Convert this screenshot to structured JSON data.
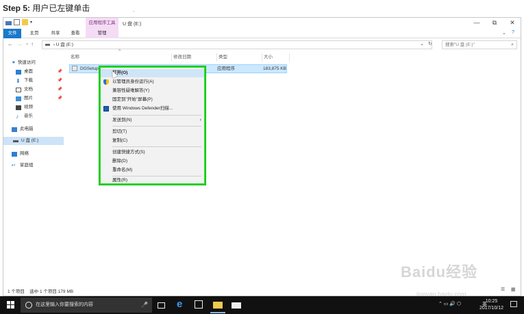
{
  "caption": {
    "step": "Step 5:",
    "text": "用户已左键单击"
  },
  "window": {
    "title": "U 盘 (E:)",
    "context_tab": "应用程序工具",
    "controls": [
      "—",
      "⧉",
      "✕"
    ]
  },
  "ribbon": {
    "tabs": [
      "文件",
      "主页",
      "共享",
      "查看",
      "管理"
    ]
  },
  "address": {
    "path": "U 盘 (E:)",
    "search_placeholder": "搜索\"U 盘 (E:)\""
  },
  "sidebar": {
    "items": [
      {
        "label": "快速访问",
        "pinned": false
      },
      {
        "label": "桌面",
        "pinned": true
      },
      {
        "label": "下载",
        "pinned": true
      },
      {
        "label": "文档",
        "pinned": true
      },
      {
        "label": "图片",
        "pinned": true
      },
      {
        "label": "视频",
        "pinned": false
      },
      {
        "label": "音乐",
        "pinned": false
      },
      {
        "label": "此电脑",
        "pinned": false
      },
      {
        "label": "U 盘 (E:)",
        "pinned": false
      },
      {
        "label": "网络",
        "pinned": false
      },
      {
        "label": "家庭组",
        "pinned": false
      }
    ]
  },
  "file_list": {
    "columns": [
      "名称",
      "修改日期",
      "类型",
      "大小"
    ],
    "rows": [
      {
        "name": "DGSetup",
        "date": "",
        "type": "应用程序",
        "size": "183,875 KB"
      }
    ]
  },
  "context_menu": {
    "items": [
      "打开(O)",
      "以管理员身份运行(A)",
      "兼容性疑难解答(Y)",
      "固定到\"开始\"屏幕(P)",
      "使用 Windows Defender扫描...",
      "发送到(N)",
      "剪切(T)",
      "复制(C)",
      "创建快捷方式(S)",
      "删除(D)",
      "重命名(M)",
      "属性(R)"
    ]
  },
  "status_bar": {
    "count": "1 个项目",
    "selected": "选中 1 个项目  179 MB"
  },
  "taskbar": {
    "search_placeholder": "在这里输入你要搜索的内容",
    "tray_lang": "英",
    "time": "10:25",
    "date": "2017/10/12"
  },
  "watermark": {
    "brand": "Baidu经验",
    "url": "jingyan.baidu.com"
  },
  "colors": {
    "highlight": "#22dd22",
    "file_tab": "#1979ca",
    "context_tab": "#f4dcf4"
  }
}
